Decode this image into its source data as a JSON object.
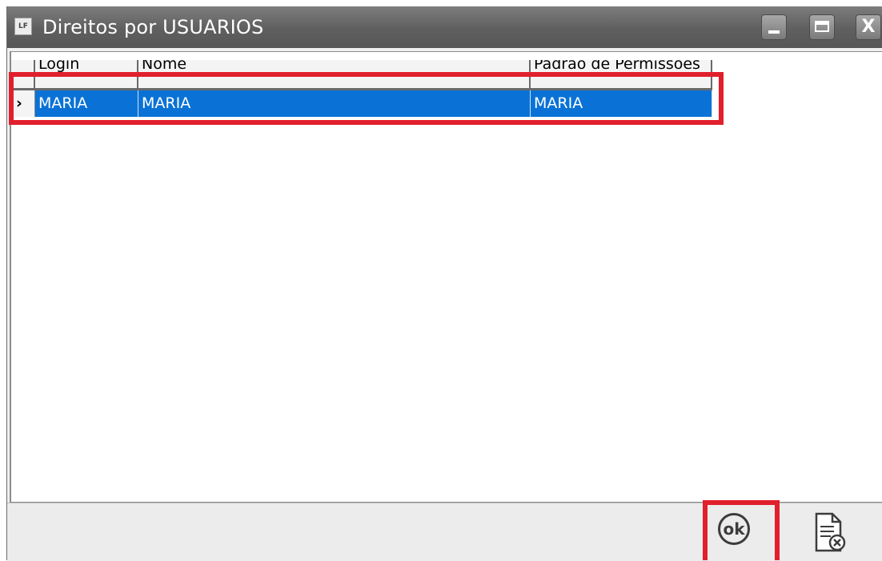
{
  "window": {
    "title": "Direitos por USUARIOS",
    "icon_text": "LF",
    "controls": [
      "minimize-icon",
      "maximize-icon",
      "close-icon"
    ],
    "close_glyph": "X"
  },
  "grid": {
    "columns": [
      "Login",
      "Nome",
      "Padrão de Permissões"
    ],
    "rows": [
      {
        "indicator": "›",
        "login": "MARIA",
        "nome": "MARIA",
        "padrao": "MARIA",
        "selected": true
      }
    ]
  },
  "footer": {
    "ok_label": "ok",
    "cancel_icon": "cancel-document-icon"
  },
  "colors": {
    "selection": "#0a72d6",
    "highlight": "#e0202c",
    "titlebar": "#666666"
  }
}
